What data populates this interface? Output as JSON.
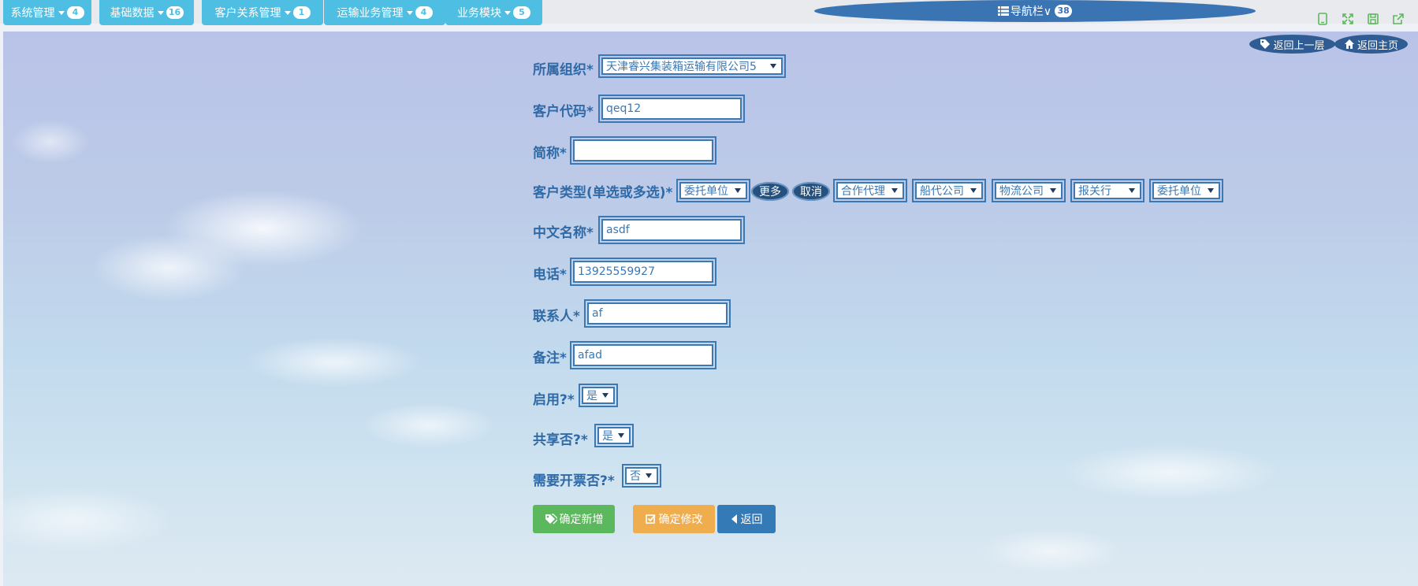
{
  "menu": [
    {
      "label": "系统管理",
      "badge": "4"
    },
    {
      "label": "基础数据",
      "badge": "16"
    },
    {
      "label": "客户关系管理",
      "badge": "1"
    },
    {
      "label": "运输业务管理",
      "badge": "4"
    },
    {
      "label": "业务模块",
      "badge": "5"
    }
  ],
  "navbar": {
    "label": "导航栏∨",
    "badge": "38"
  },
  "tools": {
    "icons": [
      "mobile-icon",
      "fullscreen-icon",
      "save-icon",
      "export-icon"
    ]
  },
  "links": {
    "back_level": "返回上一层",
    "home": "返回主页"
  },
  "form": {
    "org": {
      "label": "所属组织*",
      "value": "天津睿兴集装箱运输有限公司5"
    },
    "code": {
      "label": "客户代码*",
      "value": "qeq12"
    },
    "short_name": {
      "label": "简称*",
      "value": ""
    },
    "cust_type": {
      "label": "客户类型(单选或多选)*",
      "selects": [
        "委托单位",
        "合作代理",
        "船代公司",
        "物流公司",
        "报关行",
        "委托单位"
      ],
      "more": "更多",
      "cancel": "取消"
    },
    "cn_name": {
      "label": "中文名称*",
      "value": "asdf"
    },
    "phone": {
      "label": "电话*",
      "value": "13925559927"
    },
    "contact": {
      "label": "联系人*",
      "value": "af"
    },
    "remark": {
      "label": "备注*",
      "value": "afad"
    },
    "enabled": {
      "label": "启用?*",
      "value": "是"
    },
    "shared": {
      "label": "共享否?*",
      "value": "是"
    },
    "invoice": {
      "label": "需要开票否?*",
      "value": "否"
    }
  },
  "buttons": {
    "add": "确定新增",
    "modify": "确定修改",
    "back": "返回"
  },
  "colors": {
    "menu": "#4ebfe3",
    "label": "#2f6aa6",
    "add": "#5cb85c",
    "modify": "#f0ad4e",
    "back": "#337ab7"
  }
}
